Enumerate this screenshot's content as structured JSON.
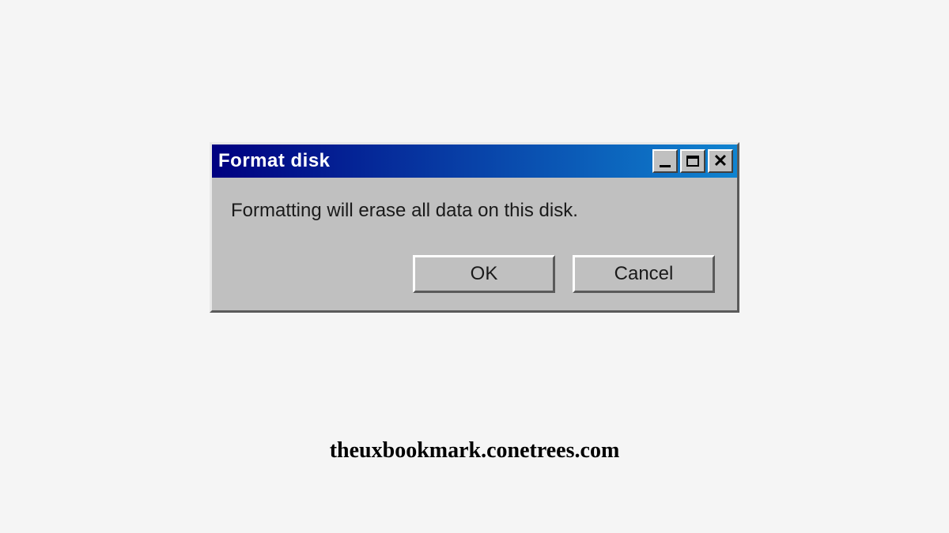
{
  "dialog": {
    "title": "Format disk",
    "message": "Formatting will erase all data on this disk.",
    "buttons": {
      "ok": "OK",
      "cancel": "Cancel"
    }
  },
  "caption": "theuxbookmark.conetrees.com"
}
